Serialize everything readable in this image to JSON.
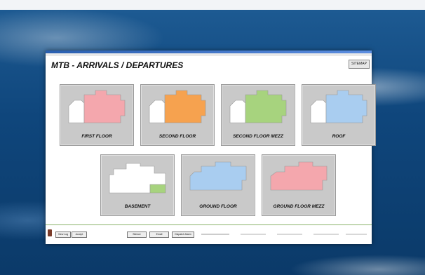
{
  "window": {
    "title": "MTB - ARRIVALS / DEPARTURES",
    "sitemap_label": "SITEMAP"
  },
  "floors": [
    {
      "label": "FIRST FLOOR",
      "color": "#f4a7ad"
    },
    {
      "label": "SECOND FLOOR",
      "color": "#f6a24f"
    },
    {
      "label": "SECOND FLOOR MEZZ",
      "color": "#a7d37e"
    },
    {
      "label": "ROOF",
      "color": "#a9cdf0"
    },
    {
      "label": "BASEMENT",
      "color": "#a7d37e"
    },
    {
      "label": "GROUND FLOOR",
      "color": "#a9cdf0"
    },
    {
      "label": "GROUND FLOOR MEZZ",
      "color": "#f4a7ad"
    }
  ],
  "toolbar": {
    "view_log": "View Log",
    "accept": "Accept",
    "silence": "Silence",
    "email": "Email",
    "dispatch_alarm": "Dispatch Alarm"
  }
}
